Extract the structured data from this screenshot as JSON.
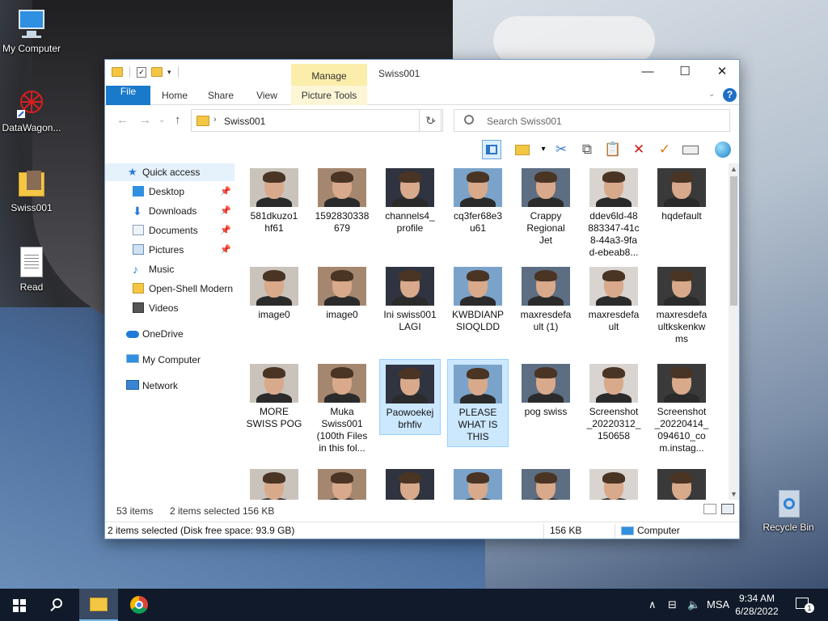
{
  "desktop": {
    "icons": [
      {
        "label": "My Computer"
      },
      {
        "label": "DataWagon..."
      },
      {
        "label": "Swiss001"
      },
      {
        "label": "Read"
      },
      {
        "label": "Recycle Bin"
      }
    ]
  },
  "window": {
    "title": "Swiss001",
    "manage_tab": "Manage",
    "ribbon_tabs": [
      "File",
      "Home",
      "Share",
      "View",
      "Picture Tools"
    ],
    "address": {
      "path": "Swiss001"
    },
    "search": {
      "placeholder": "Search Swiss001"
    },
    "controls": {
      "minimize": "—",
      "maximize": "☐",
      "close": "✕"
    }
  },
  "navpane": {
    "items": [
      {
        "label": "Quick access",
        "pinned": false
      },
      {
        "label": "Desktop",
        "pinned": true
      },
      {
        "label": "Downloads",
        "pinned": true
      },
      {
        "label": "Documents",
        "pinned": true
      },
      {
        "label": "Pictures",
        "pinned": true
      },
      {
        "label": "Music",
        "pinned": false
      },
      {
        "label": "Open-Shell Modern",
        "pinned": false
      },
      {
        "label": "Videos",
        "pinned": false
      },
      {
        "label": "OneDrive",
        "pinned": false
      },
      {
        "label": "My Computer",
        "pinned": false
      },
      {
        "label": "Network",
        "pinned": false
      }
    ]
  },
  "files": [
    {
      "name": "581dkuzo1\nhf61",
      "selected": false
    },
    {
      "name": "1592830338\n679",
      "selected": false
    },
    {
      "name": "channels4_\nprofile",
      "selected": false
    },
    {
      "name": "cq3fer68e3\nu61",
      "selected": false
    },
    {
      "name": "Crappy\nRegional\nJet",
      "selected": false
    },
    {
      "name": "ddev6ld-48\n883347-41c\n8-44a3-9fa\nd-ebeab8...",
      "selected": false
    },
    {
      "name": "hqdefault",
      "selected": false
    },
    {
      "name": "image0",
      "selected": false
    },
    {
      "name": "image0",
      "selected": false
    },
    {
      "name": "Ini swiss001\nLAGI",
      "selected": false
    },
    {
      "name": "KWBDIANP\nSIOQLDD",
      "selected": false
    },
    {
      "name": "maxresdefa\nult (1)",
      "selected": false
    },
    {
      "name": "maxresdefa\nult",
      "selected": false
    },
    {
      "name": "maxresdefa\nultkskenkw\nms",
      "selected": false
    },
    {
      "name": "MORE\nSWISS POG",
      "selected": false
    },
    {
      "name": "Muka\nSwiss001\n(100th Files\nin this fol...",
      "selected": false
    },
    {
      "name": "Paowoekej\nbrhfiv",
      "selected": true
    },
    {
      "name": "PLEASE\nWHAT IS\nTHIS",
      "selected": true
    },
    {
      "name": "pog swiss",
      "selected": false
    },
    {
      "name": "Screenshot\n_20220312_\n150658",
      "selected": false
    },
    {
      "name": "Screenshot\n_20220414_\n094610_co\nm.instag...",
      "selected": false
    },
    {
      "name": "",
      "selected": false
    },
    {
      "name": "",
      "selected": false
    },
    {
      "name": "",
      "selected": false
    },
    {
      "name": "",
      "selected": false
    },
    {
      "name": "",
      "selected": false
    },
    {
      "name": "",
      "selected": false
    },
    {
      "name": "",
      "selected": false
    }
  ],
  "infobar": {
    "count": "53 items",
    "selection": "2 items selected",
    "size": "156 KB"
  },
  "statusbar": {
    "summary": "2 items selected (Disk free space: 93.9 GB)",
    "size": "156 KB",
    "location": "Computer"
  },
  "taskbar": {
    "language": "MSA",
    "time": "9:34 AM",
    "date": "6/28/2022",
    "notifications": "1"
  },
  "colors": {
    "accent": "#1979ca",
    "selection": "#cce8ff",
    "taskbar": "#101a2a"
  }
}
